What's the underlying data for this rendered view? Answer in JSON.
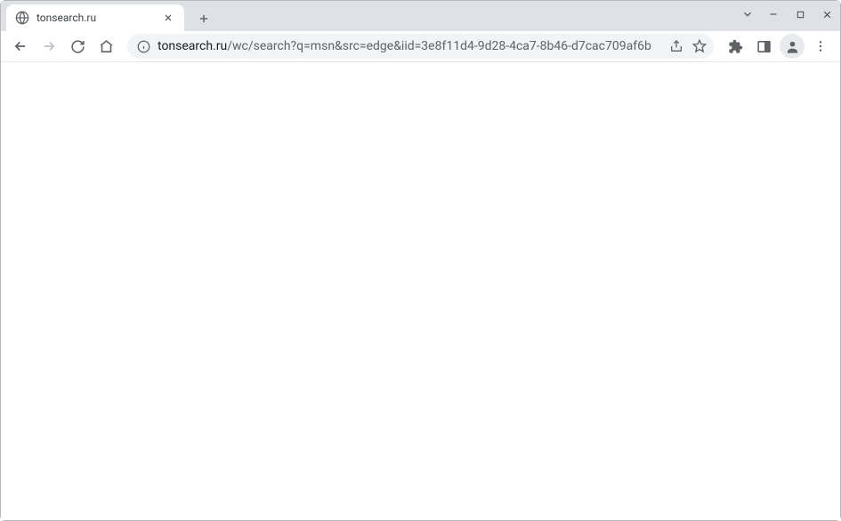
{
  "tab": {
    "title": "tonsearch.ru"
  },
  "address": {
    "domain": "tonsearch.ru",
    "path": "/wc/search?q=msn&src=edge&iid=3e8f11d4-9d28-4ca7-8b46-d7cac709af6b"
  }
}
